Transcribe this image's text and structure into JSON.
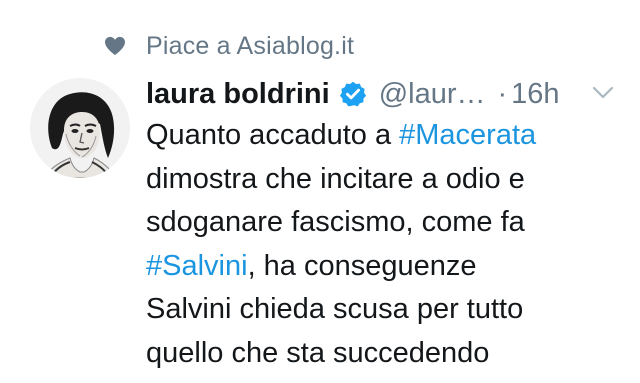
{
  "liked_by": {
    "icon": "heart-icon",
    "text": "Piace a Asiablog.it"
  },
  "tweet": {
    "author_name": "laura boldrini",
    "verified_icon": "verified-badge-icon",
    "handle": "@laur…",
    "separator": "·",
    "time": "16h",
    "menu_icon": "chevron-down-icon",
    "lines": [
      {
        "pre": "Quanto accaduto a ",
        "hashtag": "#Macerata",
        "post": ""
      },
      {
        "pre": "dimostra che incitare a odio e",
        "hashtag": "",
        "post": ""
      },
      {
        "pre": "sdoganare fascismo, come fa",
        "hashtag": "",
        "post": ""
      },
      {
        "pre": "",
        "hashtag": "#Salvini",
        "post": ", ha conseguenze"
      },
      {
        "pre": "Salvini chieda scusa per tutto",
        "hashtag": "",
        "post": ""
      },
      {
        "pre": "quello che sta succedendo",
        "hashtag": "",
        "post": ""
      }
    ]
  },
  "colors": {
    "secondary_text": "#657786",
    "hashtag": "#1b95e0",
    "verified": "#1da1f2",
    "primary_text": "#14171a"
  }
}
